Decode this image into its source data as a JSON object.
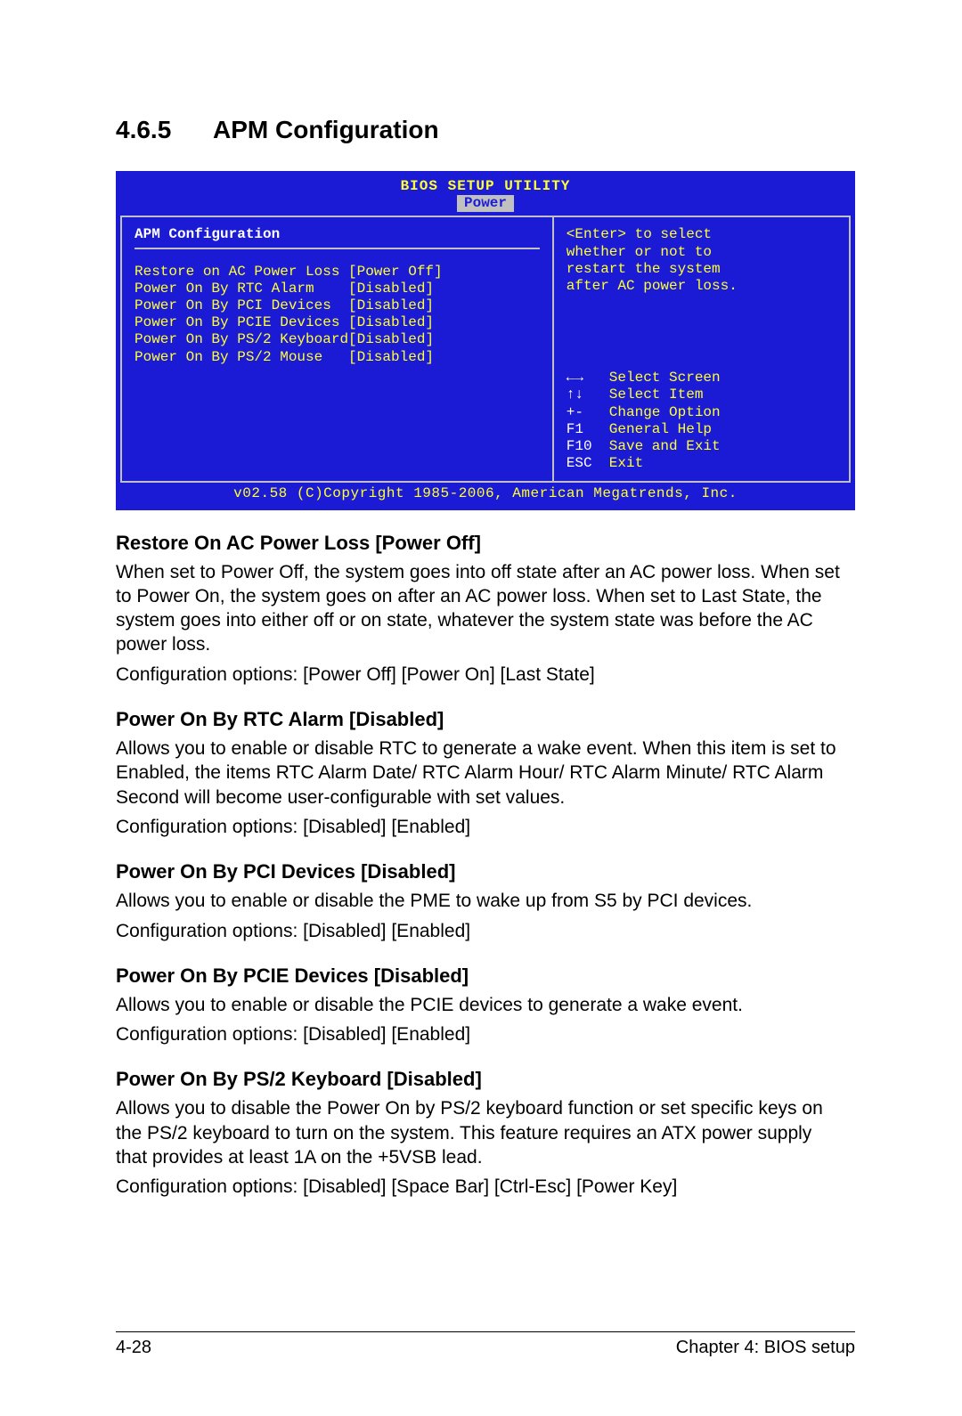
{
  "heading": {
    "number": "4.6.5",
    "title": "APM Configuration"
  },
  "bios": {
    "setup_title": "BIOS SETUP UTILITY",
    "active_tab": "Power",
    "section_title": "APM Configuration",
    "items": [
      {
        "label": "Restore on AC Power Loss",
        "value": "[Power Off]"
      },
      {
        "label": "Power On By RTC Alarm",
        "value": "[Disabled]"
      },
      {
        "label": "Power On By PCI Devices",
        "value": "[Disabled]"
      },
      {
        "label": "Power On By PCIE Devices",
        "value": "[Disabled]"
      },
      {
        "label": "Power On By PS/2 Keyboard",
        "value": "[Disabled]"
      },
      {
        "label": "Power On By PS/2 Mouse",
        "value": "[Disabled]"
      }
    ],
    "help_text": "<Enter> to select\nwhether or not to\nrestart the system\nafter AC power loss.",
    "legend": [
      {
        "key": "←→",
        "action": "Select Screen"
      },
      {
        "key": "↑↓",
        "action": "Select Item"
      },
      {
        "key": "+-",
        "action": "Change Option"
      },
      {
        "key": "F1",
        "action": "General Help"
      },
      {
        "key": "F10",
        "action": "Save and Exit"
      },
      {
        "key": "ESC",
        "action": "Exit"
      }
    ],
    "footer": "v02.58 (C)Copyright 1985-2006, American Megatrends, Inc."
  },
  "doc_sections": [
    {
      "title": "Restore On AC Power Loss [Power Off]",
      "paragraphs": [
        "When set to Power Off, the system goes into off state after an AC power loss. When set to Power On, the system goes on after an AC power loss. When set to Last State, the system goes into either off or on state, whatever the system state was before the AC power loss.",
        "Configuration options: [Power Off] [Power On] [Last State]"
      ]
    },
    {
      "title": "Power On By RTC Alarm [Disabled]",
      "paragraphs": [
        "Allows you to enable or disable RTC to generate a wake event. When this item is set to Enabled, the items RTC Alarm Date/ RTC Alarm Hour/ RTC Alarm Minute/ RTC Alarm Second will become user-configurable with set values.",
        "Configuration options: [Disabled] [Enabled]"
      ]
    },
    {
      "title": "Power On By PCI Devices [Disabled]",
      "paragraphs": [
        "Allows you to enable or disable the PME to wake up from S5 by PCI devices.",
        "Configuration options: [Disabled] [Enabled]"
      ]
    },
    {
      "title": "Power On By PCIE Devices [Disabled]",
      "paragraphs": [
        "Allows you to enable or disable the PCIE devices to generate a wake event.",
        "Configuration options: [Disabled] [Enabled]"
      ]
    },
    {
      "title": "Power On By PS/2 Keyboard [Disabled]",
      "paragraphs": [
        "Allows you to disable the Power On by PS/2 keyboard function or set specific keys on the PS/2 keyboard to turn on the system. This feature requires an ATX power supply that provides at least 1A on the +5VSB lead.",
        "Configuration options: [Disabled] [Space Bar] [Ctrl-Esc] [Power Key]"
      ]
    }
  ],
  "footer": {
    "page_number": "4-28",
    "chapter": "Chapter 4: BIOS setup"
  }
}
